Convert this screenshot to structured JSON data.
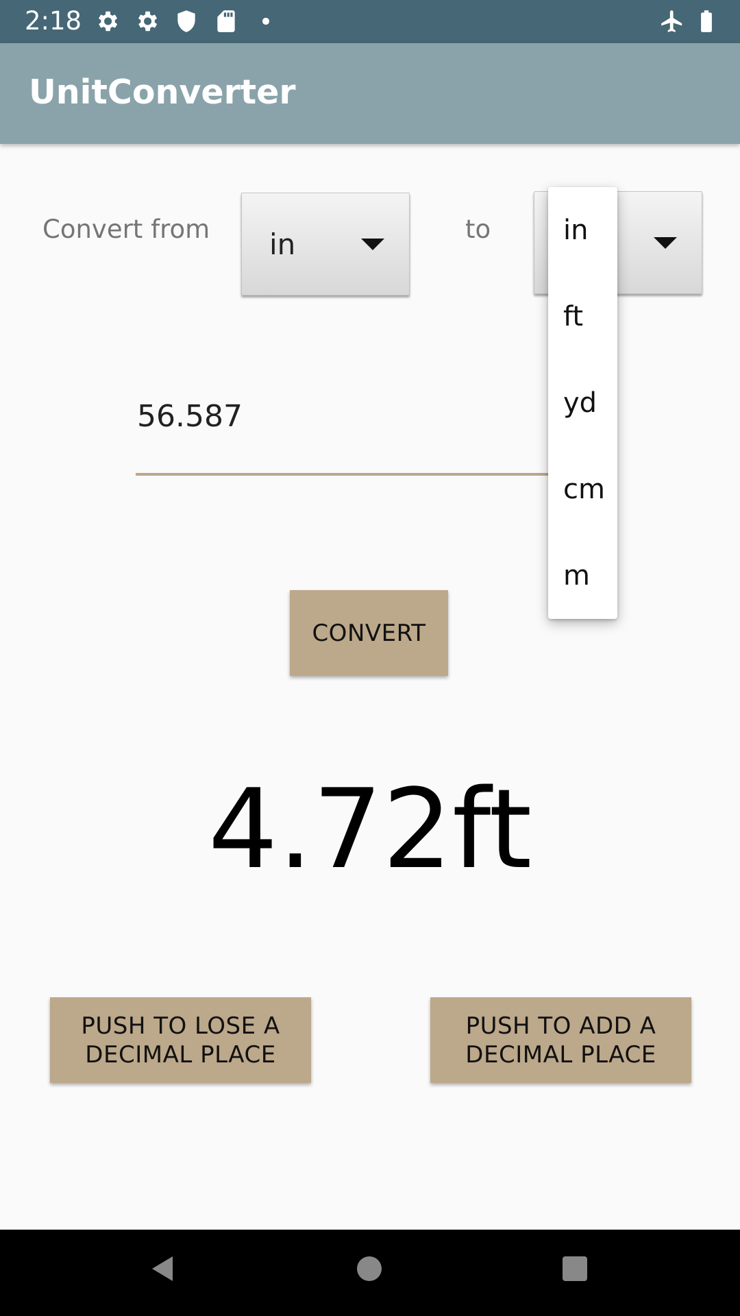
{
  "status_bar": {
    "time": "2:18",
    "icons": [
      "gear-icon",
      "gear-icon",
      "shield-icon",
      "sd-card-icon",
      "dot-icon",
      "airplane-icon",
      "battery-icon"
    ]
  },
  "app_bar": {
    "title": "UnitConverter"
  },
  "converter": {
    "from_label": "Convert from",
    "from_unit": "in",
    "to_label": "to",
    "input_value": "56.587",
    "convert_label": "CONVERT",
    "result": "4.72ft",
    "lose_decimal_label": "PUSH TO LOSE A DECIMAL PLACE",
    "add_decimal_label": "PUSH TO ADD A DECIMAL PLACE"
  },
  "dropdown": {
    "options": [
      "in",
      "ft",
      "yd",
      "cm",
      "m"
    ]
  },
  "colors": {
    "status_bar": "#456776",
    "app_bar": "#8aa3aa",
    "accent": "#bca88a",
    "background": "#fafafa"
  },
  "nav_bar": {
    "icons": [
      "back-icon",
      "home-icon",
      "recents-icon"
    ]
  }
}
